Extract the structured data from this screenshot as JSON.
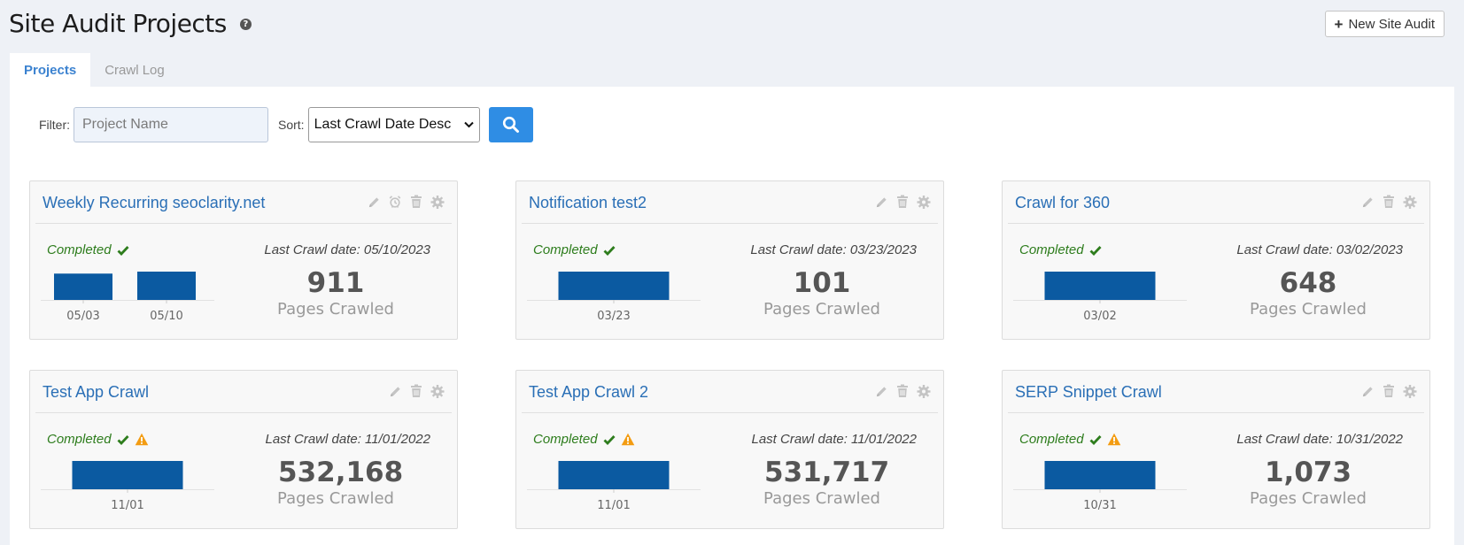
{
  "header": {
    "title": "Site Audit Projects",
    "new_button": "New Site Audit"
  },
  "tabs": [
    {
      "label": "Projects",
      "active": true
    },
    {
      "label": "Crawl Log",
      "active": false
    }
  ],
  "filter": {
    "label": "Filter:",
    "placeholder": "Project Name"
  },
  "sort": {
    "label": "Sort:",
    "value": "Last Crawl Date Desc"
  },
  "colors": {
    "accent": "#2f8de4",
    "bar": "#0b5aa1",
    "success": "#2e7d1d",
    "warning": "#f39c12",
    "title": "#2a6fb6"
  },
  "projects": [
    {
      "name": "Weekly Recurring seoclarity.net",
      "status": "Completed",
      "warning": false,
      "alarm_tool": true,
      "last_crawl": "Last Crawl date: 05/10/2023",
      "pages": "911",
      "pages_label": "Pages Crawled",
      "bars": [
        {
          "label": "05/03",
          "value": 0.93
        },
        {
          "label": "05/10",
          "value": 1.0
        }
      ]
    },
    {
      "name": "Notification test2",
      "status": "Completed",
      "warning": false,
      "alarm_tool": false,
      "last_crawl": "Last Crawl date: 03/23/2023",
      "pages": "101",
      "pages_label": "Pages Crawled",
      "bars": [
        {
          "label": "03/23",
          "value": 1.0
        }
      ]
    },
    {
      "name": "Crawl for 360",
      "status": "Completed",
      "warning": false,
      "alarm_tool": false,
      "last_crawl": "Last Crawl date: 03/02/2023",
      "pages": "648",
      "pages_label": "Pages Crawled",
      "bars": [
        {
          "label": "03/02",
          "value": 1.0
        }
      ]
    },
    {
      "name": "Test App Crawl",
      "status": "Completed",
      "warning": true,
      "alarm_tool": false,
      "last_crawl": "Last Crawl date: 11/01/2022",
      "pages": "532,168",
      "pages_label": "Pages Crawled",
      "bars": [
        {
          "label": "11/01",
          "value": 1.0
        }
      ]
    },
    {
      "name": "Test App Crawl 2",
      "status": "Completed",
      "warning": true,
      "alarm_tool": false,
      "last_crawl": "Last Crawl date: 11/01/2022",
      "pages": "531,717",
      "pages_label": "Pages Crawled",
      "bars": [
        {
          "label": "11/01",
          "value": 1.0
        }
      ]
    },
    {
      "name": "SERP Snippet Crawl",
      "status": "Completed",
      "warning": true,
      "alarm_tool": false,
      "last_crawl": "Last Crawl date: 10/31/2022",
      "pages": "1,073",
      "pages_label": "Pages Crawled",
      "bars": [
        {
          "label": "10/31",
          "value": 1.0
        }
      ]
    }
  ]
}
